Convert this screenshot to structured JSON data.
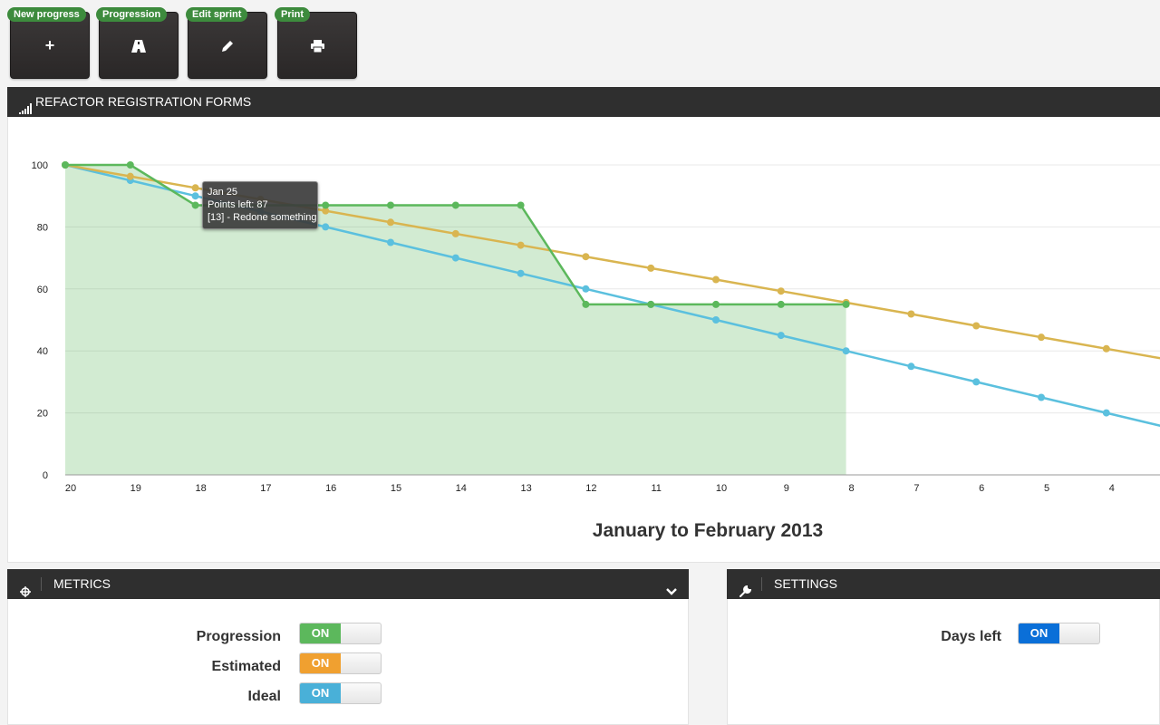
{
  "toolbar": {
    "buttons": [
      {
        "label": "New progress",
        "icon": "plus-icon"
      },
      {
        "label": "Progression",
        "icon": "road-icon"
      },
      {
        "label": "Edit sprint",
        "icon": "pencil-icon"
      },
      {
        "label": "Print",
        "icon": "print-icon"
      }
    ]
  },
  "chart_panel": {
    "title": "REFACTOR REGISTRATION FORMS",
    "icon": "signal-bars-icon"
  },
  "chart_data": {
    "type": "line",
    "title": "January to February 2013",
    "xlabel": "",
    "ylabel": "",
    "categories": [
      "20",
      "19",
      "18",
      "17",
      "16",
      "15",
      "14",
      "13",
      "12",
      "11",
      "10",
      "9",
      "8",
      "7",
      "6",
      "5",
      "4"
    ],
    "y_ticks": [
      "0",
      "20",
      "40",
      "60",
      "80",
      "100"
    ],
    "ylim": [
      0,
      100
    ],
    "grid": true,
    "series": [
      {
        "key": "ideal",
        "color": "#5bc0de",
        "values": [
          100,
          95,
          90,
          85,
          80,
          75,
          70,
          65,
          60,
          55,
          50,
          45,
          40,
          35,
          30,
          25,
          20,
          15
        ]
      },
      {
        "key": "estimated",
        "color": "#d9b550",
        "values": [
          100,
          96.3,
          92.6,
          88.9,
          85.2,
          81.5,
          77.8,
          74.1,
          70.4,
          66.7,
          63.0,
          59.3,
          55.6,
          51.9,
          48.1,
          44.4,
          40.7,
          37
        ]
      },
      {
        "key": "progression",
        "color": "#5cb85c",
        "values": [
          100,
          100,
          87,
          87,
          87,
          87,
          87,
          87,
          55,
          55,
          55,
          55,
          55
        ],
        "area": true
      }
    ]
  },
  "tooltip": {
    "date": "Jan 25",
    "points": "Points left: 87",
    "task": "[13] - Redone something"
  },
  "metrics": {
    "title": "METRICS",
    "icon": "crosshair-icon",
    "collapse_icon": "chevron-down-icon",
    "rows": [
      {
        "label": "Progression",
        "state": "ON",
        "color": "#5cb85c"
      },
      {
        "label": "Estimated",
        "state": "ON",
        "color": "#f0a030"
      },
      {
        "label": "Ideal",
        "state": "ON",
        "color": "#49b0d8"
      }
    ]
  },
  "settings": {
    "title": "SETTINGS",
    "icon": "wrench-icon",
    "rows": [
      {
        "label": "Days left",
        "state": "ON",
        "color": "#0a6fd8"
      }
    ]
  }
}
